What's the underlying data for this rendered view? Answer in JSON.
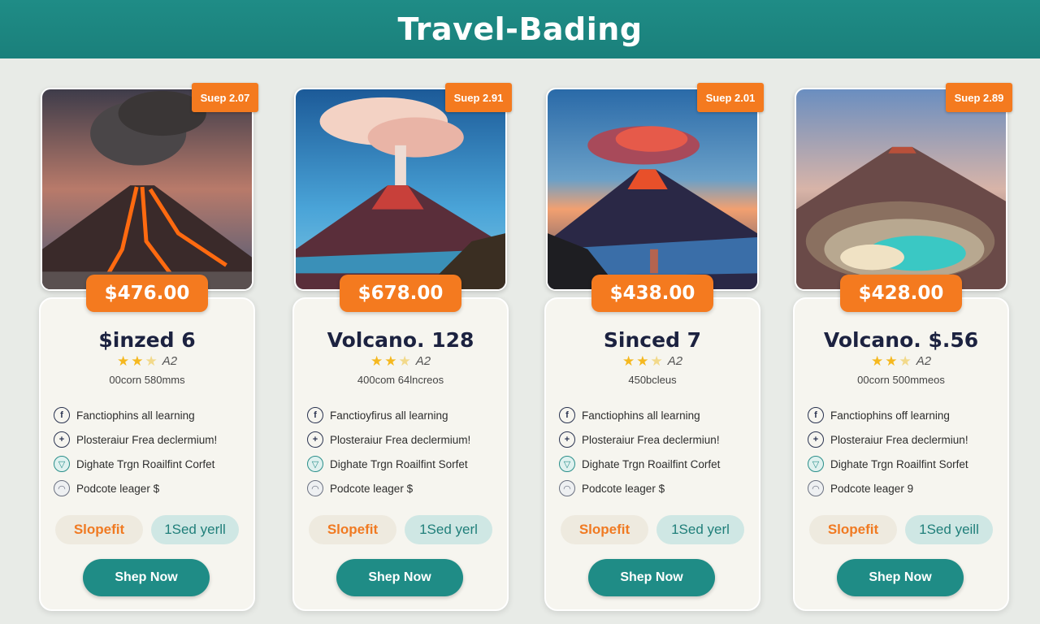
{
  "header": {
    "title": "Travel-Bading"
  },
  "cards": [
    {
      "date": "Suep 2.07",
      "price": "$476.00",
      "title": "$inzed 6",
      "rating_text": "A2",
      "subtitle": "00corn 580mms",
      "features": [
        "Fanctiophins all learning",
        "Plosteraiur Frea declermium!",
        "Dighate Trgn Roailfint Corfet",
        "Podcote leager $"
      ],
      "tag_left": "Slopefit",
      "tag_right": "1Sed yerll",
      "cta": "Shep Now"
    },
    {
      "date": "Suep 2.91",
      "price": "$678.00",
      "title": "Volcano. 128",
      "rating_text": "A2",
      "subtitle": "400com 64lncreos",
      "features": [
        "Fanctioyfirus all learning",
        "Plosteraiur Frea declermium!",
        "Dighate Trgn Roailfint Sorfet",
        "Podcote leager $"
      ],
      "tag_left": "Slopefit",
      "tag_right": "1Sed yerl",
      "cta": "Shep Now"
    },
    {
      "date": "Suep 2.01",
      "price": "$438.00",
      "title": "Sinced 7",
      "rating_text": "A2",
      "subtitle": "450bcleus",
      "features": [
        "Fanctiophins all learning",
        "Plosteraiur Frea declermiun!",
        "Dighate Trgn Roailfint Corfet",
        "Podcote leager $"
      ],
      "tag_left": "Slopefit",
      "tag_right": "1Sed yerl",
      "cta": "Shep Now"
    },
    {
      "date": "Suep 2.89",
      "price": "$428.00",
      "title": "Volcano. $.56",
      "rating_text": "A2",
      "subtitle": "00corn 500mmeos",
      "features": [
        "Fanctiophins off learning",
        "Plosteraiur Frea declermiun!",
        "Dighate Trgn Roailfint Sorfet",
        "Podcote leager 9"
      ],
      "tag_left": "Slopefit",
      "tag_right": "1Sed yeill",
      "cta": "Shep Now"
    }
  ],
  "icons": [
    "info-icon",
    "plus-icon",
    "shield-icon",
    "cloud-icon"
  ],
  "colors": {
    "accent": "#1f8c86",
    "orange": "#f47a1f",
    "star": "#f5b81f"
  }
}
